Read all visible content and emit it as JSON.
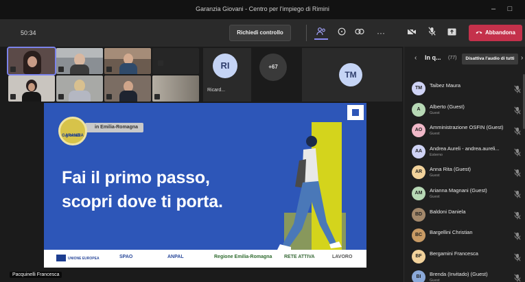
{
  "window": {
    "title": "Garanzia Giovani - Centro per l'impiego di Rimini"
  },
  "toolbar": {
    "timer": "50:34",
    "request_control": "Richiedi controllo",
    "leave": "Abbandona",
    "icons": [
      "people-icon",
      "chat-icon",
      "reactions-icon",
      "more-icon",
      "camera-off-icon",
      "mic-off-icon",
      "share-icon"
    ]
  },
  "stage": {
    "tile_initials_1": "RI",
    "tile_name_1": "Ricard...",
    "overflow_count": "+67",
    "tile_initials_2": "TM",
    "presenter": "Pacquinelli Francesca"
  },
  "slide": {
    "badge_text_1": "GARANZIA",
    "badge_text_2": "giovani",
    "region": "in Emilia-Romagna",
    "headline_1": "Fai il primo passo,",
    "headline_2": "scopri dove ti porta.",
    "logos": [
      "UNIONE EUROPEA",
      "SPAO",
      "ANPAL",
      "Regione Emilia-Romagna",
      "RETE ATTIVA",
      "LAVORO"
    ]
  },
  "panel": {
    "title": "In q...",
    "count": "(77)",
    "mute_all": "Disattiva l'audio di tutti",
    "participants": [
      {
        "initials": "TM",
        "name": "Taibez Maura",
        "role": "",
        "color": "#cfd3f5"
      },
      {
        "initials": "A",
        "name": "Alberto (Guest)",
        "role": "Guest",
        "color": "#b7d8b5"
      },
      {
        "initials": "AO",
        "name": "Amministrazione OSFIN (Guest)",
        "role": "Guest",
        "color": "#f0b8c8"
      },
      {
        "initials": "AA",
        "name": "Andrea Aureli - andrea.aureli...",
        "role": "Esterno",
        "color": "#cfd3f5"
      },
      {
        "initials": "AR",
        "name": "Anna Rita (Guest)",
        "role": "Guest",
        "color": "#f2d29b"
      },
      {
        "initials": "AM",
        "name": "Arianna Magnani (Guest)",
        "role": "Guest",
        "color": "#b7d8b5"
      },
      {
        "initials": "BD",
        "name": "Baldoni Daniela",
        "role": "",
        "color": "#a3886b"
      },
      {
        "initials": "BC",
        "name": "Bargellini Christian",
        "role": "",
        "color": "#c89a64"
      },
      {
        "initials": "BF",
        "name": "Bergamini Francesca",
        "role": "",
        "color": "#f2d29b"
      },
      {
        "initials": "BI",
        "name": "Brenda (Invitado) (Guest)",
        "role": "Guest",
        "color": "#8aa8d8"
      }
    ]
  }
}
